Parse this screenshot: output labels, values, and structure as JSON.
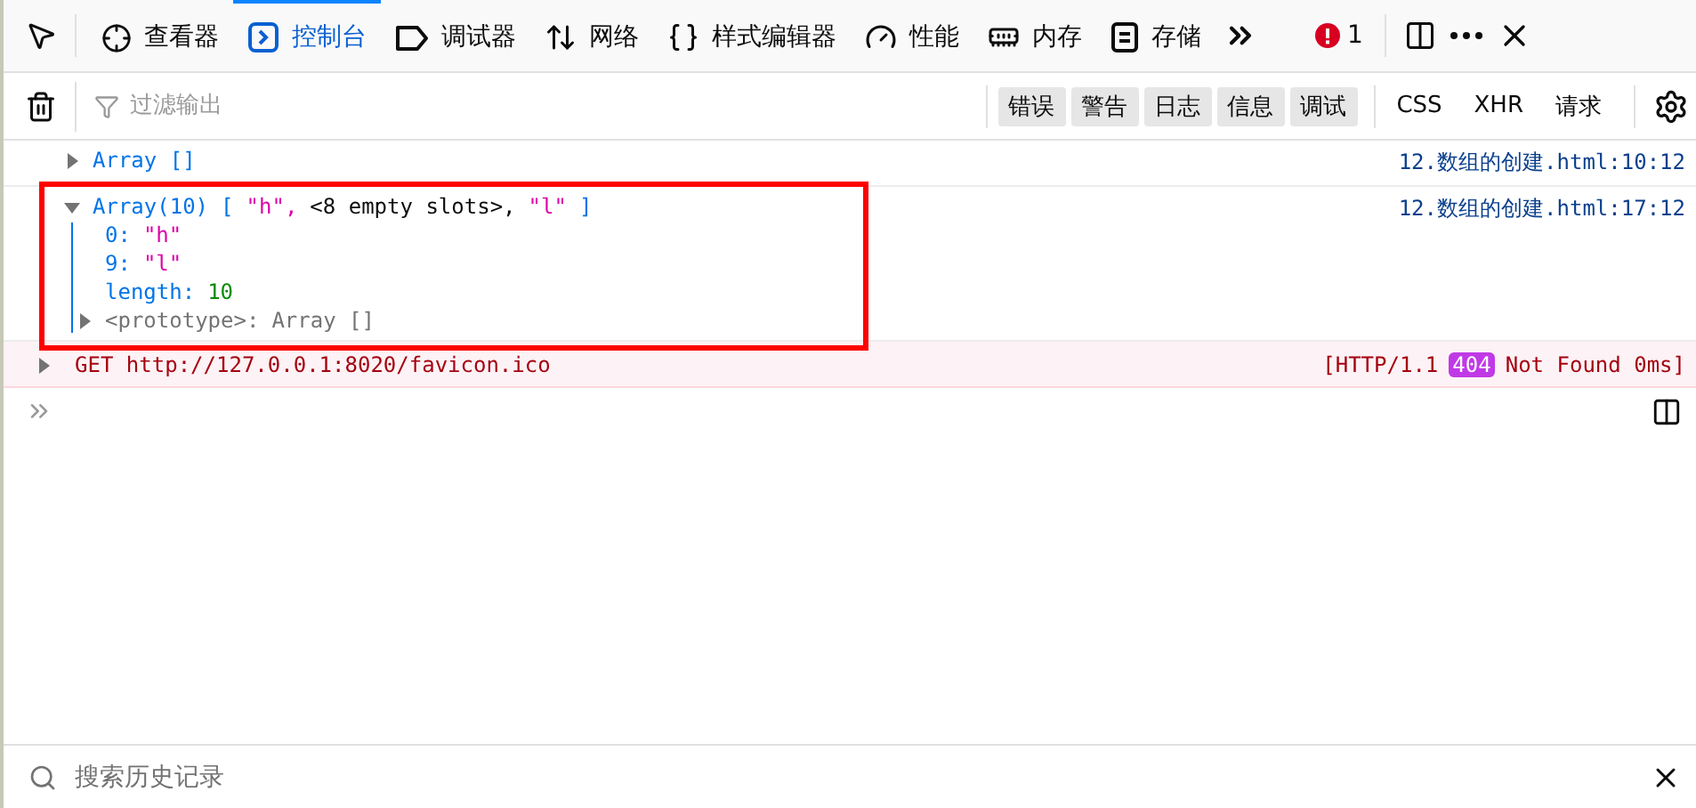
{
  "toolbar": {
    "tabs": [
      {
        "kind": "inspector",
        "label": "查看器",
        "selected": false
      },
      {
        "kind": "console",
        "label": "控制台",
        "selected": true
      },
      {
        "kind": "debugger",
        "label": "调试器",
        "selected": false
      },
      {
        "kind": "network",
        "label": "网络",
        "selected": false
      },
      {
        "kind": "style",
        "label": "样式编辑器",
        "selected": false
      },
      {
        "kind": "performance",
        "label": "性能",
        "selected": false
      },
      {
        "kind": "memory",
        "label": "内存",
        "selected": false
      },
      {
        "kind": "storage",
        "label": "存储",
        "selected": false
      }
    ],
    "error_count": "1"
  },
  "filter_bar": {
    "placeholder": "过滤输出",
    "levels": [
      {
        "label": "错误",
        "selected": true
      },
      {
        "label": "警告",
        "selected": true
      },
      {
        "label": "日志",
        "selected": true
      },
      {
        "label": "信息",
        "selected": true
      },
      {
        "label": "调试",
        "selected": true
      }
    ],
    "types": [
      {
        "label": "CSS",
        "selected": false
      },
      {
        "label": "XHR",
        "selected": false
      },
      {
        "label": "请求",
        "selected": false
      }
    ]
  },
  "messages": [
    {
      "kind": "log",
      "text": "Array []",
      "source_file": "12.数组的创建",
      "source_rest": ".html:10:12"
    },
    {
      "kind": "tree",
      "expanded": true,
      "highlighted": true,
      "source_file": "12.数组的创建",
      "source_rest": ".html:17:12",
      "header": [
        {
          "kind": "name",
          "text": "Array(10)"
        },
        {
          "kind": "punct",
          "text": "["
        },
        {
          "kind": "string",
          "text": "\"h\","
        },
        {
          "kind": "plain",
          "text": "<8 empty slots>,"
        },
        {
          "kind": "string",
          "text": "\"l\""
        },
        {
          "kind": "punct",
          "text": "]"
        }
      ],
      "properties": [
        {
          "key": "0:",
          "value": "\"h\"",
          "kind": "string"
        },
        {
          "key": "9:",
          "value": "\"l\"",
          "kind": "string"
        },
        {
          "key": "length:",
          "value": "10",
          "kind": "number"
        }
      ],
      "prototype": {
        "key": "<prototype>:",
        "value": "Array []",
        "expanded": false
      }
    },
    {
      "kind": "error",
      "method": "GET",
      "url": "http://127.0.0.1:8020/favicon.ico",
      "protocol": "[HTTP/1.1",
      "status": "404",
      "status_text": "Not Found 0ms]"
    }
  ],
  "search": {
    "placeholder": "搜索历史记录"
  }
}
